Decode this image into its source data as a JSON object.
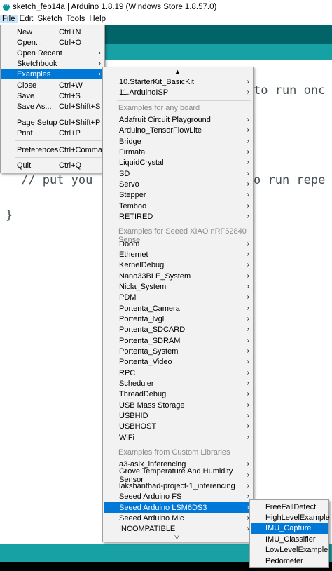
{
  "window": {
    "title": "sketch_feb14a | Arduino 1.8.19 (Windows Store 1.8.57.0)"
  },
  "menubar": [
    "File",
    "Edit",
    "Sketch",
    "Tools",
    "Help"
  ],
  "code": {
    "line1": "to run onc",
    "line2": "// put you",
    "line2b": "o run repe",
    "brace": "}"
  },
  "file_menu": [
    {
      "label": "New",
      "shortcut": "Ctrl+N"
    },
    {
      "label": "Open...",
      "shortcut": "Ctrl+O"
    },
    {
      "label": "Open Recent",
      "submenu": true
    },
    {
      "label": "Sketchbook",
      "submenu": true
    },
    {
      "label": "Examples",
      "submenu": true,
      "highlighted": true
    },
    {
      "label": "Close",
      "shortcut": "Ctrl+W"
    },
    {
      "label": "Save",
      "shortcut": "Ctrl+S"
    },
    {
      "label": "Save As...",
      "shortcut": "Ctrl+Shift+S"
    },
    {
      "label": "Page Setup",
      "shortcut": "Ctrl+Shift+P"
    },
    {
      "label": "Print",
      "shortcut": "Ctrl+P"
    },
    {
      "label": "Preferences",
      "shortcut": "Ctrl+Comma"
    },
    {
      "label": "Quit",
      "shortcut": "Ctrl+Q"
    }
  ],
  "examples_menu": {
    "top": [
      "10.StarterKit_BasicKit",
      "11.ArduinoISP"
    ],
    "header_any": "Examples for any board",
    "any_board": [
      "Adafruit Circuit Playground",
      "Arduino_TensorFlowLite",
      "Bridge",
      "Firmata",
      "LiquidCrystal",
      "SD",
      "Servo",
      "Stepper",
      "Temboo",
      "RETIRED"
    ],
    "header_board": "Examples for Seeed XIAO nRF52840 Sense",
    "board": [
      "Doom",
      "Ethernet",
      "KernelDebug",
      "Nano33BLE_System",
      "Nicla_System",
      "PDM",
      "Portenta_Camera",
      "Portenta_lvgl",
      "Portenta_SDCARD",
      "Portenta_SDRAM",
      "Portenta_System",
      "Portenta_Video",
      "RPC",
      "Scheduler",
      "ThreadDebug",
      "USB Mass Storage",
      "USBHID",
      "USBHOST",
      "WiFi"
    ],
    "header_custom": "Examples from Custom Libraries",
    "custom": [
      "a3-asix_inferencing",
      "Grove Temperature And Humidity Sensor",
      "lakshanthad-project-1_inferencing",
      "Seeed Arduino FS",
      "Seeed Arduino LSM6DS3",
      "Seeed Arduino Mic",
      "INCOMPATIBLE"
    ],
    "highlighted": "Seeed Arduino LSM6DS3"
  },
  "lsm_menu": {
    "items": [
      "FreeFallDetect",
      "HighLevelExample",
      "IMU_Capture",
      "IMU_Classifier",
      "LowLevelExample",
      "Pedometer"
    ],
    "highlighted": "IMU_Capture"
  },
  "colors": {
    "accent": "#0078d7",
    "teal_dark": "#006468",
    "teal": "#17a1a5"
  }
}
